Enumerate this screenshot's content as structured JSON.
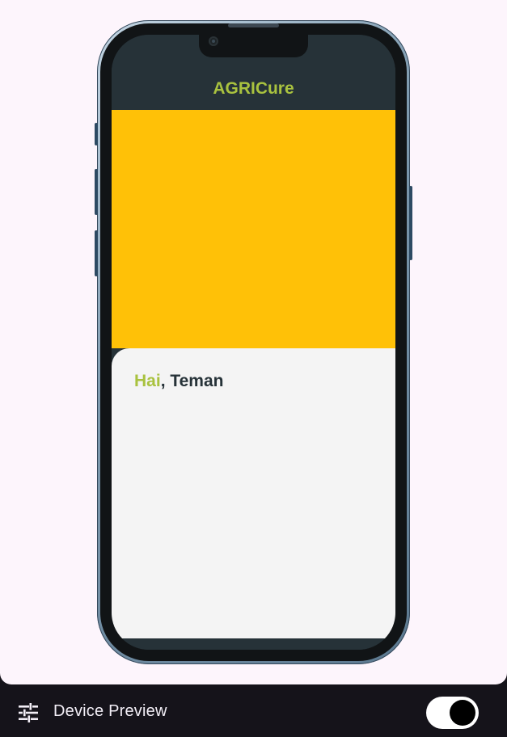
{
  "app": {
    "title": "AGRICure"
  },
  "home": {
    "greeting_hi": "Hai",
    "greeting_rest": ", Teman"
  },
  "colors": {
    "app_bar": "#263238",
    "accent": "#a9c23f",
    "banner": "#ffc107",
    "content_bg": "#f4f4f4"
  },
  "toolbar": {
    "settings_icon": "tune-icon",
    "label": "Device Preview",
    "toggle_on": true
  }
}
